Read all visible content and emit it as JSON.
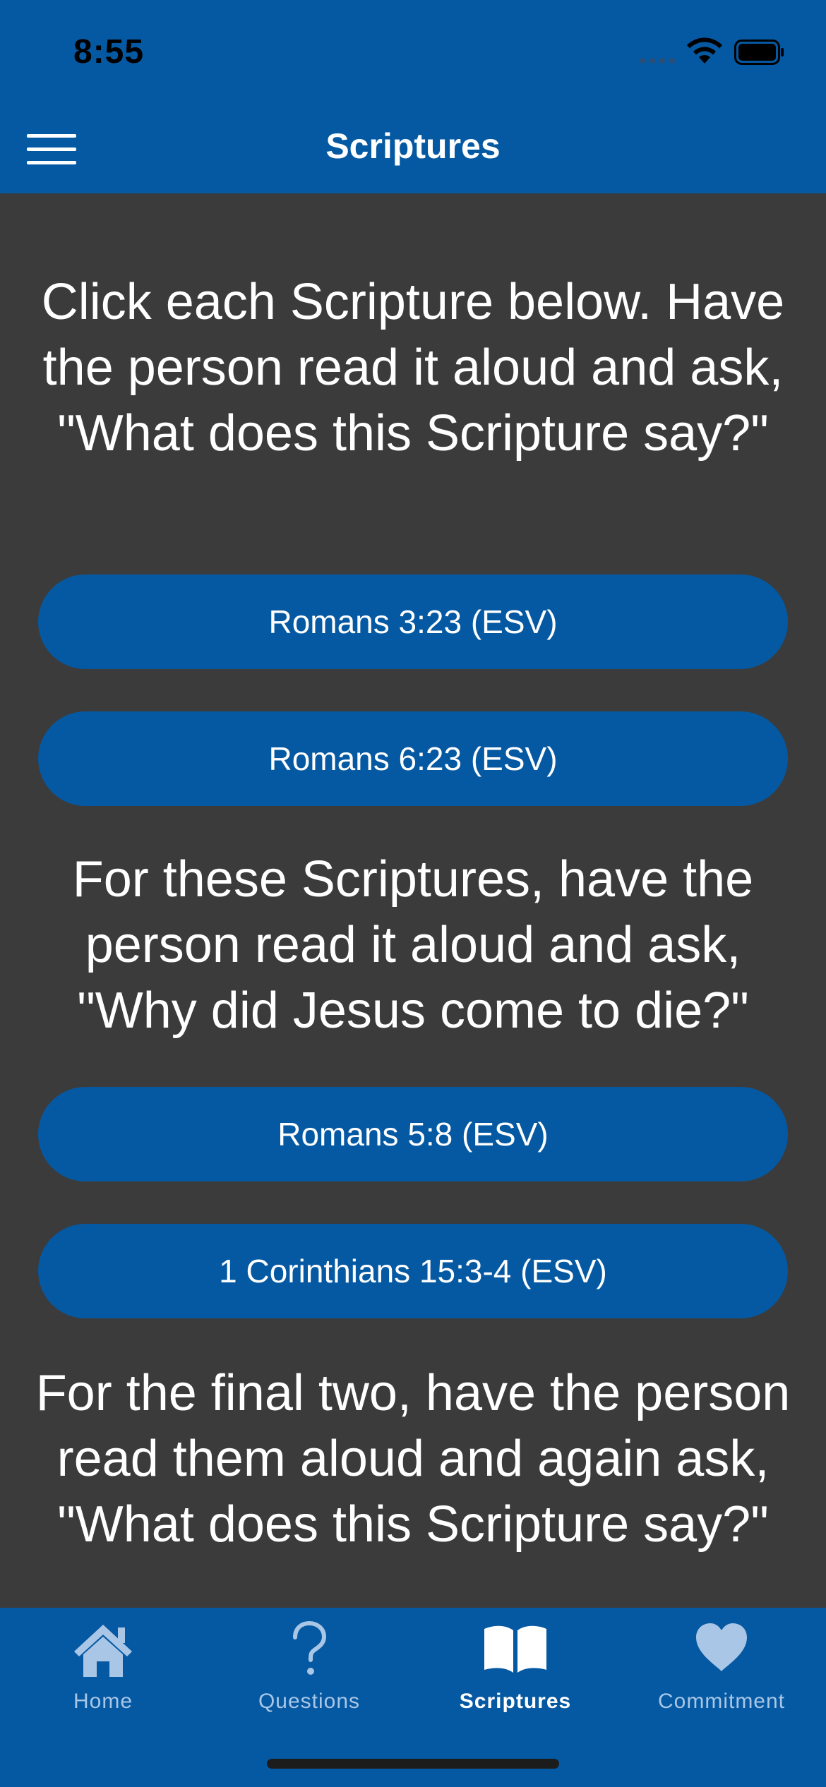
{
  "status_bar": {
    "time": "8:55"
  },
  "nav": {
    "title": "Scriptures"
  },
  "content": {
    "intro_text": "Click each Scripture below. Have the person read it aloud and ask, \"What does this Scripture say?\"",
    "section1_buttons": [
      "Romans 3:23 (ESV)",
      "Romans 6:23 (ESV)"
    ],
    "section2_text": "For these Scriptures, have the person read it aloud and ask, \"Why did Jesus come to die?\"",
    "section2_buttons": [
      "Romans 5:8 (ESV)",
      "1 Corinthians 15:3-4 (ESV)"
    ],
    "section3_text": "For the final two, have the person read them aloud and again ask, \"What does this Scripture say?\""
  },
  "tab_bar": {
    "tabs": [
      {
        "label": "Home",
        "icon": "house-icon",
        "active": false
      },
      {
        "label": "Questions",
        "icon": "question-mark-icon",
        "active": false
      },
      {
        "label": "Scriptures",
        "icon": "open-book-icon",
        "active": true
      },
      {
        "label": "Commitment",
        "icon": "heart-icon",
        "active": false
      }
    ]
  },
  "colors": {
    "brand_blue": "#0559a2",
    "background": "#3b3b3b",
    "inactive_tab": "#a9c6e6",
    "active_tab": "#ffffff"
  }
}
